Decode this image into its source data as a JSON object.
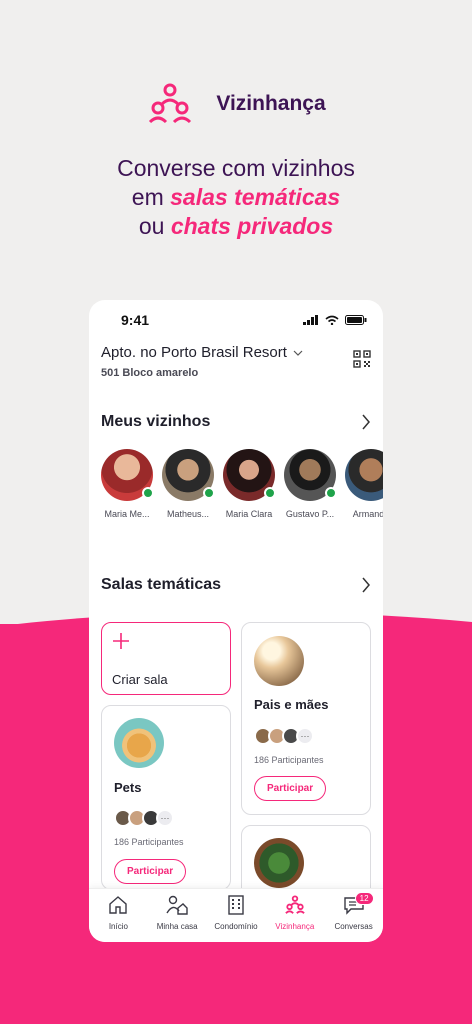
{
  "brand": {
    "title": "Vizinhança",
    "color": "#f5287a"
  },
  "headline": {
    "line1": "Converse com vizinhos",
    "line2_prefix": "em ",
    "line2_highlight": "salas temáticas",
    "line3_prefix": "ou ",
    "line3_highlight": "chats privados"
  },
  "status_bar": {
    "time": "9:41"
  },
  "address": {
    "title": "Apto. no Porto Brasil Resort",
    "subtitle": "501 Bloco amarelo"
  },
  "neighbors": {
    "title": "Meus vizinhos",
    "items": [
      {
        "name": "Maria Me...",
        "color": "#b33a3a"
      },
      {
        "name": "Matheus...",
        "color": "#6b5a4a"
      },
      {
        "name": "Maria Clara",
        "color": "#5a2a2a"
      },
      {
        "name": "Gustavo P...",
        "color": "#4a4a4a"
      },
      {
        "name": "Armando",
        "color": "#7a5a44"
      }
    ]
  },
  "rooms": {
    "title": "Salas temáticas",
    "create_label": "Criar sala",
    "items": [
      {
        "name": "Pais e mães",
        "participants": "186 Participantes",
        "join_label": "Participar",
        "more": "···"
      },
      {
        "name": "Pets",
        "participants": "186 Participantes",
        "join_label": "Participar",
        "more": "···"
      }
    ]
  },
  "tabs": [
    {
      "label": "Início",
      "icon": "home-icon"
    },
    {
      "label": "Minha casa",
      "icon": "person-house-icon"
    },
    {
      "label": "Condomínio",
      "icon": "building-icon"
    },
    {
      "label": "Vizinhança",
      "icon": "neighbors-icon",
      "active": true
    },
    {
      "label": "Conversas",
      "icon": "chat-icon",
      "badge": "12"
    }
  ]
}
